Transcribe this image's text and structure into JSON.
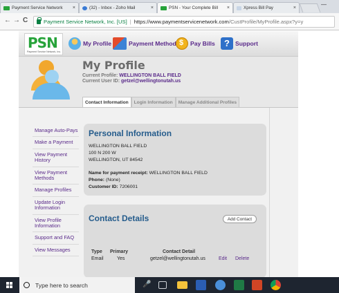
{
  "browser": {
    "tabs": [
      {
        "label": "Payment Service Network",
        "favicon_color": "#27a33a"
      },
      {
        "label": "(32) - Inbox - Zoho Mail",
        "favicon_color": "#3a7bd5"
      },
      {
        "label": "PSN - Your Complete Bill",
        "favicon_color": "#27a33a"
      },
      {
        "label": "Xpress Bill Pay",
        "favicon_color": "#c9d6e6"
      }
    ],
    "close_glyph": "×",
    "minimize_glyph": "—",
    "nav": {
      "back": "←",
      "forward": "→",
      "reload": "C"
    },
    "url": {
      "secure_label": "Payment Service Network, Inc. [US]",
      "separator": "|",
      "host": "https://www.paymentservicenetwork.com",
      "path": "/CustProfile/MyProfile.aspx?y=y"
    }
  },
  "site": {
    "logo_text": "PSN",
    "logo_sub": "Payment Service Network, Inc.",
    "nav": [
      {
        "label": "My Profile",
        "icon": "profile-icon"
      },
      {
        "label": "Payment Methods",
        "icon": "payment-methods-icon"
      },
      {
        "label": "Pay Bills",
        "icon": "pay-bills-icon"
      },
      {
        "label": "Support",
        "icon": "support-icon"
      }
    ],
    "page_title": "My Profile",
    "current_profile_label": "Current Profile:",
    "current_profile_value": "WELLINGTON BALL FIELD",
    "current_user_label": "Current User ID:",
    "current_user_value": "getzel@wellingtonutah.us",
    "subtabs": [
      "Contact Information",
      "Login Information",
      "Manage Additional Profiles"
    ],
    "sidebar": [
      "Manage Auto-Pays",
      "Make a Payment",
      "View Payment History",
      "View Payment Methods",
      "Manage Profiles",
      "Update Login Information",
      "View Profile Information",
      "Support and FAQ",
      "View Messages"
    ],
    "personal": {
      "title": "Personal Information",
      "name": "WELLINGTON BALL FIELD",
      "address1": "100 N 200 W",
      "address2": "WELLINGTON, UT 84542",
      "receipt_label": "Name for payment receipt:",
      "receipt_value": "WELLINGTON BALL FIELD",
      "phone_label": "Phone:",
      "phone_value": "(None)",
      "customer_label": "Customer ID:",
      "customer_value": "7206001"
    },
    "contact": {
      "title": "Contact Details",
      "add_button": "Add Contact",
      "headers": [
        "Type",
        "Primary",
        "Contact Detail"
      ],
      "rows": [
        {
          "type": "Email",
          "primary": "Yes",
          "detail": "getzel@wellingtonutah.us",
          "edit": "Edit",
          "delete": "Delete"
        }
      ]
    }
  },
  "taskbar": {
    "search_placeholder": "Type here to search",
    "icons": [
      "microphone-icon",
      "task-view-icon",
      "file-explorer-icon",
      "word-icon",
      "people-icon",
      "excel-icon",
      "powerpoint-icon",
      "chrome-icon"
    ]
  }
}
